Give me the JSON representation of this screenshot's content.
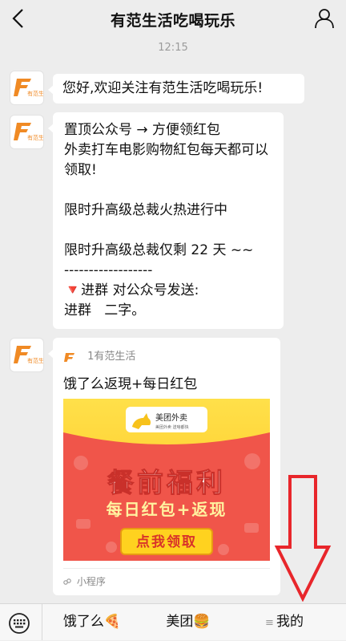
{
  "header": {
    "title": "有范生活吃喝玩乐",
    "back_icon": "chevron-left-icon",
    "profile_icon": "person-icon"
  },
  "chat": {
    "timestamp": "12:15",
    "messages": [
      {
        "lines": [
          "您好,欢迎关注有范生活吃喝玩乐!"
        ]
      },
      {
        "lines": [
          "置顶公众号 → 方便领红包",
          "外卖打车电影购物紅包每天都可以",
          "领取!",
          "",
          "限时升高级总裁火热进行中",
          "",
          "限时升高级总裁仅剩 22 天 ~~",
          "------------------",
          "🔻进群 对公众号发送:",
          "进群   二字。"
        ]
      }
    ],
    "mini_program": {
      "source": "1有范生活",
      "title": "饿了么返現+每日红包",
      "banner_brand": "美团外卖",
      "banner_brand_sub": "美团外卖 送啥都快",
      "banner_headline": "餐前福利",
      "banner_subline": "每日红包+返现",
      "banner_button": "点我领取",
      "footer": "小程序"
    },
    "avatar_text": "有范生活"
  },
  "bottom_menu": {
    "items": [
      "饿了么🍕",
      "美团🍔",
      "我的"
    ],
    "keyboard_icon": "keyboard-icon"
  },
  "colors": {
    "background": "#ededed",
    "bubble": "#ffffff",
    "brand_orange": "#f08a24",
    "banner_red": "#f0554a",
    "banner_yellow": "#ffd21f",
    "arrow_red": "#e8262b"
  }
}
